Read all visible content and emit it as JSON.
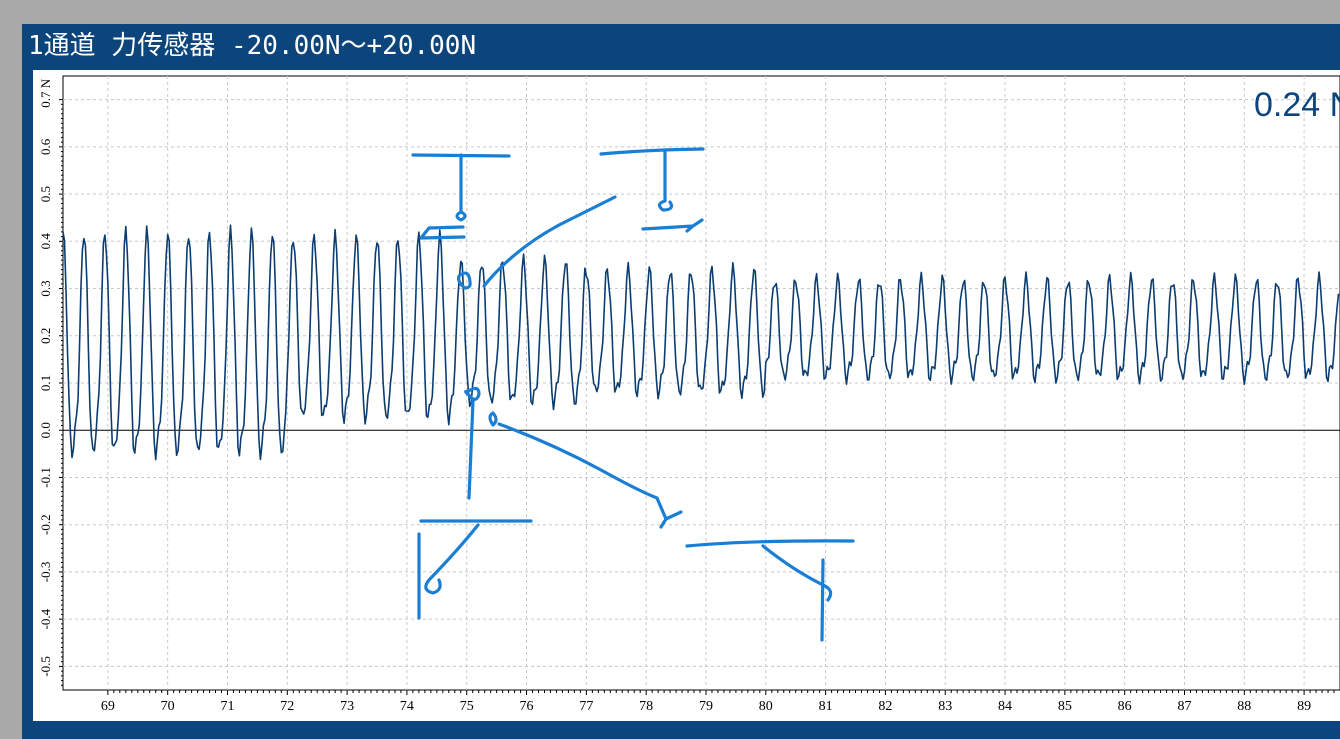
{
  "window": {
    "title": "1通道 力传感器 -20.00N～+20.00N"
  },
  "readout": {
    "value": "0.24 N"
  },
  "colors": {
    "frame": "#0c447c",
    "signal": "#0c3d70",
    "annotation": "#1a7fd4",
    "grid": "#c8c8c8"
  },
  "chart_data": {
    "type": "line",
    "title": "",
    "xlabel": "",
    "ylabel": "",
    "y_unit": "N",
    "xlim": [
      68.25,
      89.6
    ],
    "ylim": [
      -0.55,
      0.75
    ],
    "x_ticks": [
      "69",
      "70",
      "71",
      "72",
      "73",
      "74",
      "75",
      "76",
      "77",
      "78",
      "79",
      "80",
      "81",
      "82",
      "83",
      "84",
      "85",
      "86",
      "87",
      "88",
      "89"
    ],
    "y_ticks": [
      "0.7",
      "0.6",
      "0.5",
      "0.4",
      "0.3",
      "0.2",
      "0.1",
      "0.0",
      "-0.1",
      "-0.2",
      "-0.3",
      "-0.4",
      "-0.5"
    ],
    "grid": true,
    "series": [
      {
        "values_description": "periodic force oscillation, ~2.85 cycles per unit time",
        "period": 0.35,
        "segments": [
          {
            "x_from": 68.25,
            "x_to": 72.0,
            "peak": 0.42,
            "trough": -0.03
          },
          {
            "x_from": 72.0,
            "x_to": 74.8,
            "peak": 0.41,
            "trough": 0.04
          },
          {
            "x_from": 74.8,
            "x_to": 77.0,
            "peak": 0.36,
            "trough": 0.07
          },
          {
            "x_from": 77.0,
            "x_to": 80.0,
            "peak": 0.34,
            "trough": 0.09
          },
          {
            "x_from": 80.0,
            "x_to": 89.6,
            "peak": 0.32,
            "trough": 0.12
          }
        ]
      }
    ]
  }
}
